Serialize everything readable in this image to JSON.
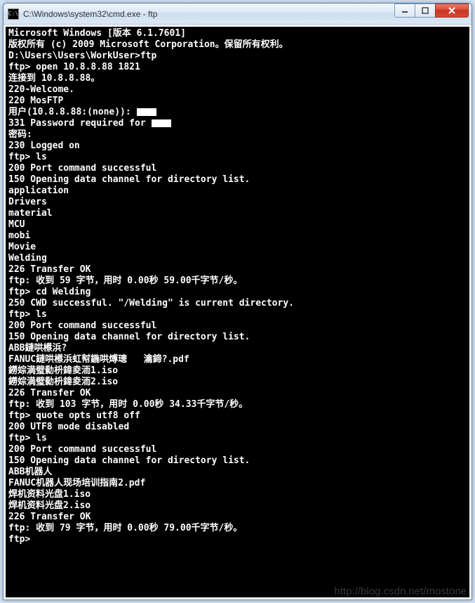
{
  "titlebar": {
    "icon_text": "C:\\",
    "title": "C:\\Windows\\system32\\cmd.exe - ftp"
  },
  "controls": {
    "minimize": "─",
    "maximize": "□",
    "close": "✕"
  },
  "lines": [
    "Microsoft Windows [版本 6.1.7601]",
    "版权所有 (c) 2009 Microsoft Corporation。保留所有权利。",
    "",
    "D:\\Users\\Users\\WorkUser>ftp",
    "ftp> open 10.8.8.88 1821",
    "连接到 10.8.8.88。",
    "220-Welcome.",
    "220 MosFTP",
    "用户(10.8.8.88:(none)): ",
    "331 Password required for ",
    "密码:",
    "230 Logged on",
    "ftp> ls",
    "200 Port command successful",
    "150 Opening data channel for directory list.",
    "application",
    "Drivers",
    "material",
    "MCU",
    "mobi",
    "Movie",
    "Welding",
    "226 Transfer OK",
    "ftp: 收到 59 字节，用时 0.00秒 59.00千字节/秒。",
    "ftp> cd Welding",
    "250 CWD successful. \"/Welding\" is current directory.",
    "ftp> ls",
    "200 Port command successful",
    "150 Opening data channel for directory list.",
    "ABB鏈哄櫒浜?",
    "FANUC鏈哄櫒浜虹幇鍦哄煿璁   瀹鍗?.pdf",
    "鐒婃満璧勬枡鍏夌洏1.iso",
    "鐒婃満璧勬枡鍏夌洏2.iso",
    "226 Transfer OK",
    "ftp: 收到 103 字节，用时 0.00秒 34.33千字节/秒。",
    "ftp> quote opts utf8 off",
    "200 UTF8 mode disabled",
    "ftp> ls",
    "200 Port command successful",
    "150 Opening data channel for directory list.",
    "ABB机器人",
    "FANUC机器人现场培训指南2.pdf",
    "焊机资料光盘1.iso",
    "焊机资料光盘2.iso",
    "226 Transfer OK",
    "ftp: 收到 79 字节，用时 0.00秒 79.00千字节/秒。",
    "ftp>"
  ],
  "redacted_lines": [
    8,
    9
  ],
  "watermark": "http://blog.csdn.net/mostone"
}
